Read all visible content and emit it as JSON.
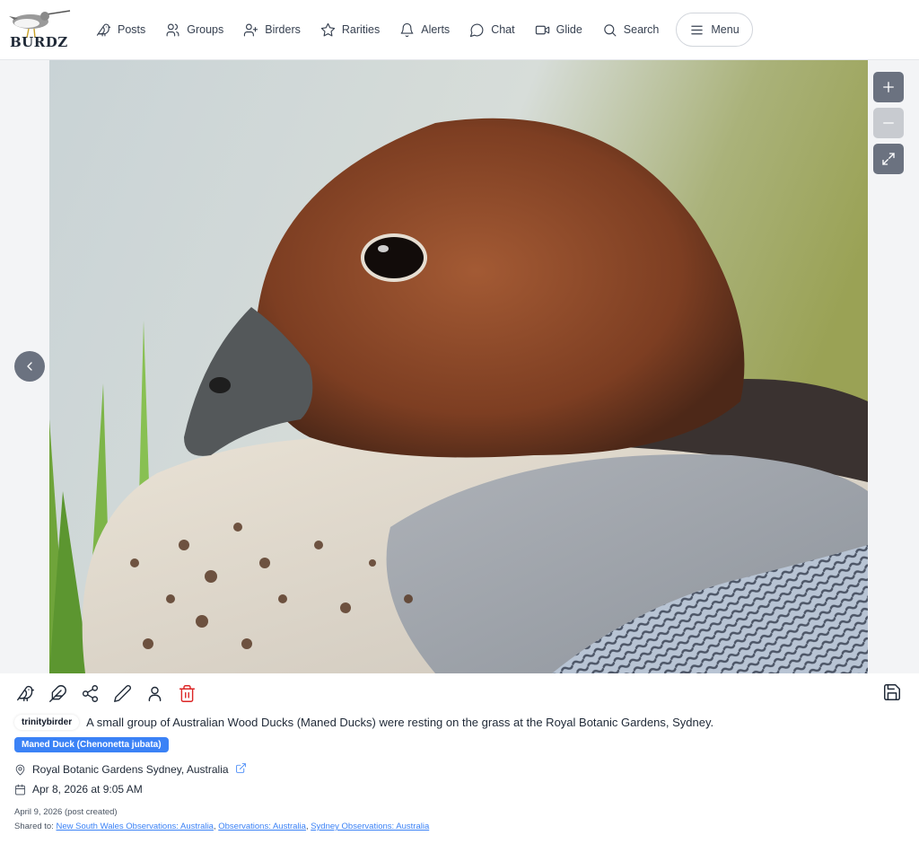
{
  "brand": {
    "name": "BURDZ"
  },
  "nav": [
    {
      "label": "Posts",
      "icon": "bird-icon"
    },
    {
      "label": "Groups",
      "icon": "users-icon"
    },
    {
      "label": "Birders",
      "icon": "user-plus-icon"
    },
    {
      "label": "Rarities",
      "icon": "star-icon"
    },
    {
      "label": "Alerts",
      "icon": "bell-icon"
    },
    {
      "label": "Chat",
      "icon": "chat-bubble-icon"
    },
    {
      "label": "Glide",
      "icon": "video-icon"
    },
    {
      "label": "Search",
      "icon": "search-icon"
    },
    {
      "label": "Menu",
      "icon": "hamburger-icon"
    }
  ],
  "viewer": {
    "zoom_in_icon": "plus-icon",
    "zoom_out_icon": "minus-icon",
    "fullscreen_icon": "expand-icon",
    "prev_icon": "chevron-left-icon"
  },
  "post": {
    "username": "trinitybirder",
    "caption": "A small group of Australian Wood Ducks (Maned Ducks) were resting on the grass at the Royal Botanic Gardens, Sydney.",
    "species_tag": "Maned Duck (Chenonetta jubata)",
    "location": "Royal Botanic Gardens Sydney, Australia",
    "observed": "Apr 8, 2026 at 9:05 AM",
    "created": "April 9, 2026 (post created)",
    "shared_label": "Shared to:",
    "shared_groups": [
      "New South Wales Observations: Australia",
      "Observations: Australia",
      "Sydney Observations: Australia"
    ]
  },
  "colors": {
    "accent": "#3b82f6",
    "delete": "#dc2626",
    "control_gray": "#6b7280"
  }
}
